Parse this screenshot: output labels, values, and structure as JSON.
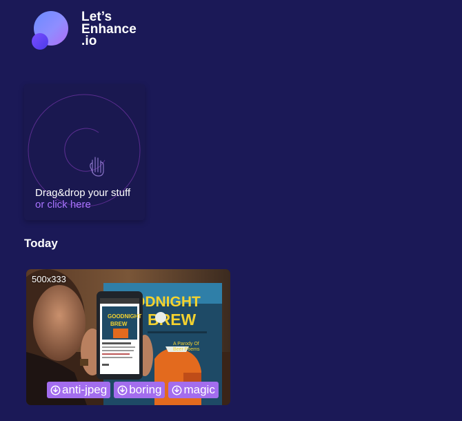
{
  "brand": {
    "line1": "Let’s",
    "line2": "Enhance",
    "line3": ".io"
  },
  "upload": {
    "title": "Drag&drop your stuff",
    "link": "or click here",
    "icon": "hand-icon"
  },
  "section": {
    "title": "Today"
  },
  "results": [
    {
      "size": "500x333",
      "thumbnail": "photo-thumbnail",
      "downloads": [
        {
          "label": "anti-jpeg",
          "icon": "download-icon"
        },
        {
          "label": "boring",
          "icon": "download-icon"
        },
        {
          "label": "magic",
          "icon": "download-icon"
        }
      ]
    }
  ],
  "colors": {
    "background": "#1b1957",
    "accent": "#a36dee",
    "link": "#a974ff"
  }
}
